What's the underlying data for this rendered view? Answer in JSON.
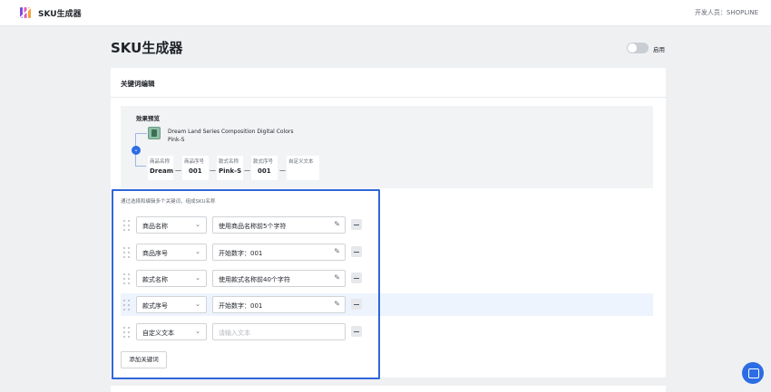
{
  "app": {
    "title": "SKU生成器",
    "developer": "开发人员：SHOPLINE"
  },
  "page": {
    "title": "SKU生成器",
    "toggle_label": "启用",
    "toggle_on": false
  },
  "editor": {
    "title": "关键词编辑",
    "preview": {
      "title": "效果预览",
      "product_name": "Dream Land Series Composition Digital Colors",
      "product_variant": "Pink-S",
      "segments": [
        {
          "label": "商品名称",
          "value": "Dream"
        },
        {
          "label": "商品序号",
          "value": "001"
        },
        {
          "label": "款式名称",
          "value": "Pink-S"
        },
        {
          "label": "款式序号",
          "value": "001"
        },
        {
          "label": "自定义文本",
          "value": ""
        }
      ],
      "separator": "—"
    },
    "hint": "通过选择和编辑多个关键词，组成SKU名称",
    "keywords": [
      {
        "type": "商品名称",
        "value": "使用商品名称前5个字符",
        "placeholder": false
      },
      {
        "type": "商品序号",
        "value": "开始数字：001",
        "placeholder": false
      },
      {
        "type": "款式名称",
        "value": "使用款式名称前40个字符",
        "placeholder": false
      },
      {
        "type": "款式序号",
        "value": "开始数字：001",
        "placeholder": false
      },
      {
        "type": "自定义文本",
        "value": "请输入文本",
        "placeholder": true
      }
    ],
    "add_label": "添加关键词"
  },
  "colors": {
    "primary": "#2c6ce5",
    "frame": "#2f66d9",
    "background": "#eff0f2",
    "highlight": "#eef4fe"
  },
  "icons": {
    "logo": "sku-logo-icon",
    "edit": "pencil-icon",
    "remove": "minus-icon",
    "help": "chat-icon",
    "arrow": "chevron-down-icon"
  }
}
